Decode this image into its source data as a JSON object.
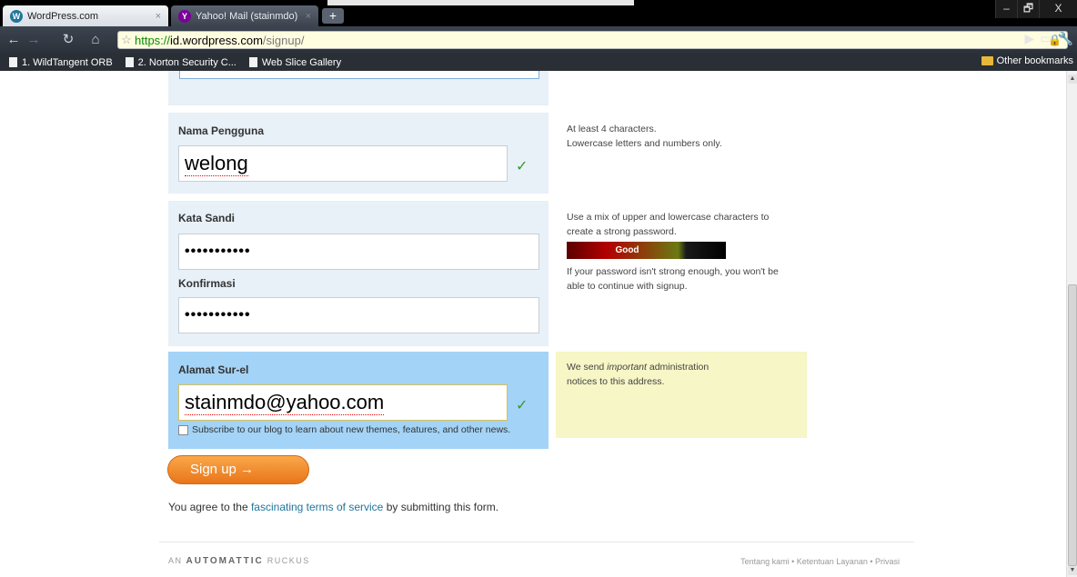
{
  "browser": {
    "tabs": [
      {
        "title": "WordPress.com",
        "icon": "wordpress-icon",
        "active": true
      },
      {
        "title": "Yahoo! Mail (stainmdo)",
        "icon": "yahoo-icon",
        "active": false
      }
    ],
    "new_tab_label": "+",
    "window_controls": [
      "–",
      "🗗",
      "X"
    ],
    "url": {
      "scheme": "https://",
      "host": "id.wordpress.com",
      "path": "/signup/"
    },
    "bookmarks": [
      "1. WildTangent ORB",
      "2. Norton Security C...",
      "Web Slice Gallery"
    ],
    "other_bookmarks": "Other bookmarks"
  },
  "form": {
    "username": {
      "label": "Nama Pengguna",
      "value": "welong",
      "valid": true
    },
    "password": {
      "label": "Kata Sandi",
      "value": "•••••••••••"
    },
    "confirm": {
      "label": "Konfirmasi",
      "value": "•••••••••••"
    },
    "email": {
      "label": "Alamat Sur-el",
      "value": "stainmdo@yahoo.com",
      "valid": true
    },
    "subscribe_label": "Subscribe to our blog to learn about new themes, features, and other news.",
    "subscribe_checked": false,
    "signup_button": "Sign up →"
  },
  "hints": {
    "username_line1": "At least 4 characters.",
    "username_line2": "Lowercase letters and numbers only.",
    "password_line1": "Use a mix of upper and lowercase characters to",
    "password_line2": "create a strong password.",
    "strength_label": "Good",
    "strength_level": "good",
    "password_warn1": "If your password isn't strong enough, you won't be",
    "password_warn2": "able to continue with signup.",
    "email_pre": "We send ",
    "email_em": "important",
    "email_post": " administration",
    "email_line2": "notices to this address."
  },
  "agreement": {
    "pre": "You agree to the ",
    "link": "fascinating terms of service",
    "post": " by submitting this form."
  },
  "footer": {
    "brand_prefix": "AN ",
    "brand_name": "AUTOMATTIC",
    "brand_suffix": " RUCKUS",
    "links": "Tentang kami • Ketentuan Layanan • Privasi"
  },
  "colors": {
    "accent_link": "#21759b",
    "signup_orange": "#f39433",
    "email_highlight": "#a3d3f7",
    "hint_yellow": "#f6f6c6",
    "valid_green": "#3a9a2a"
  }
}
